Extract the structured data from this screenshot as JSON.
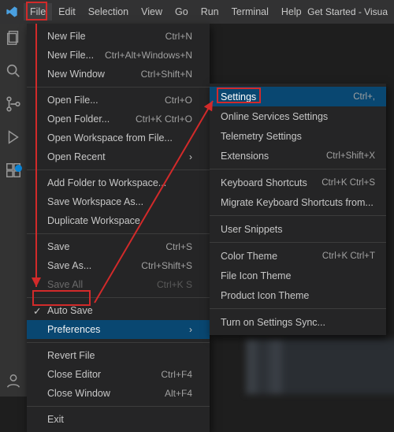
{
  "title_right": "Get Started - Visua",
  "menubar": [
    "File",
    "Edit",
    "Selection",
    "View",
    "Go",
    "Run",
    "Terminal",
    "Help"
  ],
  "file_menu": {
    "group1": [
      {
        "label": "New File",
        "shortcut": "Ctrl+N"
      },
      {
        "label": "New File...",
        "shortcut": "Ctrl+Alt+Windows+N"
      },
      {
        "label": "New Window",
        "shortcut": "Ctrl+Shift+N"
      }
    ],
    "group2": [
      {
        "label": "Open File...",
        "shortcut": "Ctrl+O"
      },
      {
        "label": "Open Folder...",
        "shortcut": "Ctrl+K Ctrl+O"
      },
      {
        "label": "Open Workspace from File...",
        "shortcut": ""
      },
      {
        "label": "Open Recent",
        "shortcut": ""
      }
    ],
    "group3": [
      {
        "label": "Add Folder to Workspace...",
        "shortcut": ""
      },
      {
        "label": "Save Workspace As...",
        "shortcut": ""
      },
      {
        "label": "Duplicate Workspace",
        "shortcut": ""
      }
    ],
    "group4": [
      {
        "label": "Save",
        "shortcut": "Ctrl+S"
      },
      {
        "label": "Save As...",
        "shortcut": "Ctrl+Shift+S"
      },
      {
        "label": "Save All",
        "shortcut": "Ctrl+K S",
        "disabled": true
      }
    ],
    "autosave": "Auto Save",
    "preferences": "Preferences",
    "group5": [
      {
        "label": "Revert File",
        "shortcut": ""
      },
      {
        "label": "Close Editor",
        "shortcut": "Ctrl+F4"
      },
      {
        "label": "Close Window",
        "shortcut": "Alt+F4"
      }
    ],
    "exit": "Exit"
  },
  "preferences_submenu": {
    "settings": {
      "label": "Settings",
      "shortcut": "Ctrl+,"
    },
    "g1": [
      "Online Services Settings",
      "Telemetry Settings",
      {
        "label": "Extensions",
        "shortcut": "Ctrl+Shift+X"
      }
    ],
    "g2": [
      {
        "label": "Keyboard Shortcuts",
        "shortcut": "Ctrl+K Ctrl+S"
      },
      "Migrate Keyboard Shortcuts from..."
    ],
    "g3": [
      "User Snippets"
    ],
    "g4": [
      {
        "label": "Color Theme",
        "shortcut": "Ctrl+K Ctrl+T"
      },
      "File Icon Theme",
      "Product Icon Theme"
    ],
    "g5": [
      "Turn on Settings Sync..."
    ]
  },
  "colors": {
    "titlebar": "#323233",
    "activitybar": "#333333",
    "menu_bg": "#252526",
    "highlight": "#094771",
    "anno_red": "#d22a2a"
  }
}
